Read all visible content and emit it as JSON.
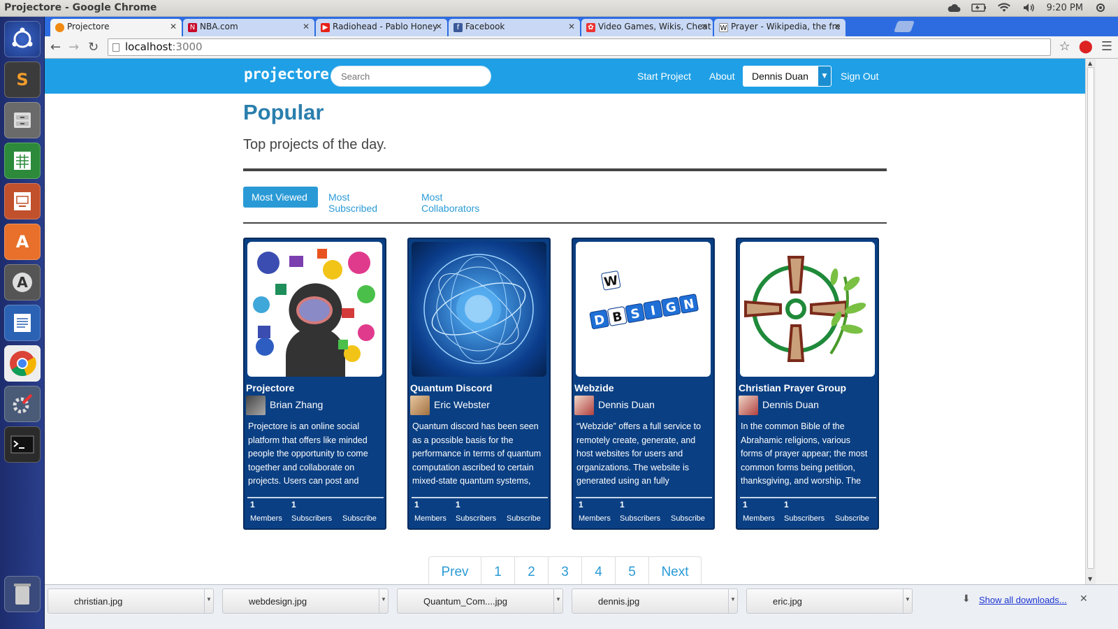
{
  "window": {
    "title": "Projectore - Google Chrome",
    "clock": "9:20 PM"
  },
  "tabs": [
    {
      "label": "Projectore",
      "fav_color": "#f08a12",
      "fav_glyph": "●"
    },
    {
      "label": "NBA.com",
      "fav_color": "#c9082a",
      "fav_glyph": "N"
    },
    {
      "label": "Radiohead - Pablo Honey",
      "fav_color": "#e62117",
      "fav_glyph": "▶"
    },
    {
      "label": "Facebook",
      "fav_color": "#3b5998",
      "fav_glyph": "f"
    },
    {
      "label": "Video Games, Wikis, Cheat",
      "fav_color": "#e33",
      "fav_glyph": "✿"
    },
    {
      "label": "Prayer - Wikipedia, the fre",
      "fav_color": "#fff",
      "fav_glyph": "W"
    }
  ],
  "omnibox": {
    "host": "localhost",
    "port": ":3000"
  },
  "site": {
    "brand": "projectore",
    "search_placeholder": "Search",
    "nav": {
      "start_project": "Start Project",
      "about": "About",
      "user": "Dennis Duan",
      "sign_out": "Sign Out"
    },
    "heading": "Popular",
    "subheading": "Top projects of the day.",
    "filters": {
      "most_viewed": "Most Viewed",
      "most_subscribed": "Most Subscribed",
      "most_collaborators": "Most Collaborators"
    }
  },
  "projects": [
    {
      "title": "Projectore",
      "owner": "Brian Zhang",
      "description": "Projectore is an online social platform that offers like minded people the opportunity to come together and collaborate on projects. Users can post and",
      "members": "1",
      "subscribers": "1",
      "members_label": "Members",
      "subscribers_label": "Subscribers",
      "subscribe_label": "Subscribe",
      "image_icon": "brain-head-icon"
    },
    {
      "title": "Quantum Discord",
      "owner": "Eric Webster",
      "description": "Quantum discord has been seen as a possible basis for the performance in terms of quantum computation ascribed to certain mixed-state quantum systems,",
      "members": "1",
      "subscribers": "1",
      "members_label": "Members",
      "subscribers_label": "Subscribers",
      "subscribe_label": "Subscribe",
      "image_icon": "quantum-sphere-icon"
    },
    {
      "title": "Webzide",
      "owner": "Dennis Duan",
      "description": "“Webzide” offers a full service to remotely create, generate, and host websites for users and organizations. The website is generated using an fully",
      "members": "1",
      "subscribers": "1",
      "members_label": "Members",
      "subscribers_label": "Subscribers",
      "subscribe_label": "Subscribe",
      "image_icon": "web-design-cubes-icon",
      "cube_letters_row": "DESIGN",
      "cube_letters_col": "WEB"
    },
    {
      "title": "Christian Prayer Group",
      "owner": "Dennis Duan",
      "description": "In the common Bible of the Abrahamic religions, various forms of prayer appear; the most common forms being petition, thanksgiving, and worship. The",
      "members": "1",
      "subscribers": "1",
      "members_label": "Members",
      "subscribers_label": "Subscribers",
      "subscribe_label": "Subscribe",
      "image_icon": "cross-olive-branch-icon"
    }
  ],
  "pagination": [
    "Prev",
    "1",
    "2",
    "3",
    "4",
    "5",
    "Next"
  ],
  "downloads": {
    "items": [
      "christian.jpg",
      "webdesign.jpg",
      "Quantum_Com....jpg",
      "dennis.jpg",
      "eric.jpg"
    ],
    "show_all": "Show all downloads..."
  },
  "colors": {
    "navbar": "#1fa0e6",
    "card_bg": "#0a3f83",
    "heading": "#2a7fad",
    "accent": "#2a9ad6"
  }
}
